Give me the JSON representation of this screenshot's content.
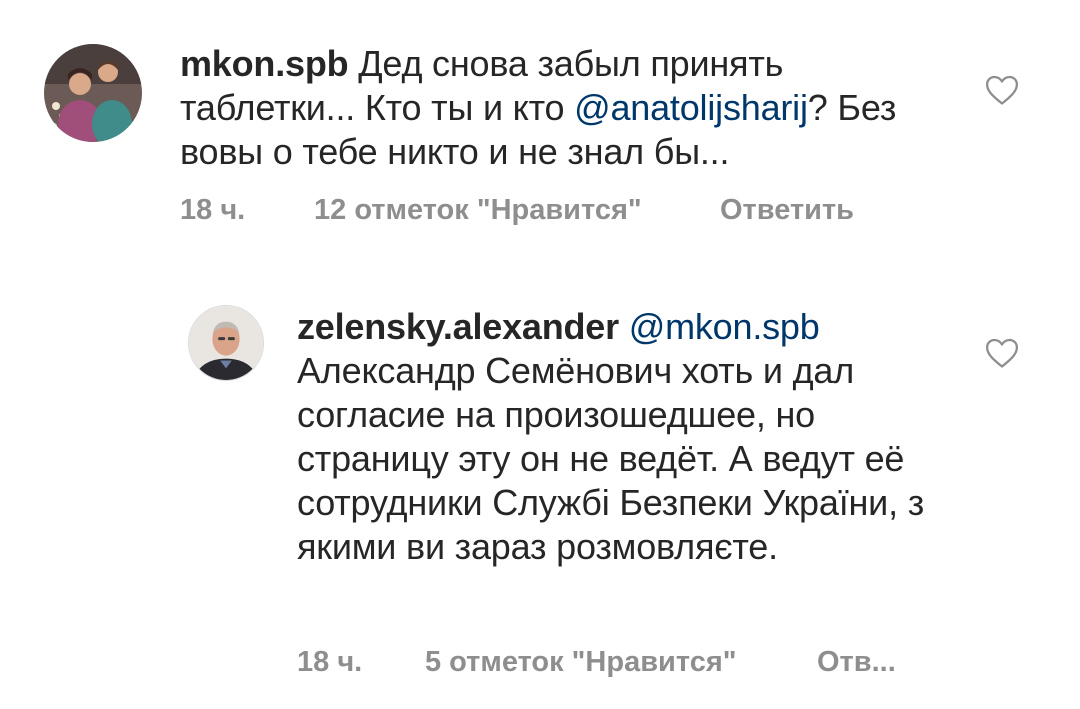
{
  "comments": [
    {
      "username": "mkon.spb",
      "text_before_mention": "Дед снова забыл принять таблетки... Кто ты и кто ",
      "mention": "@anatolijsharij",
      "text_after_mention": "? Без вовы о тебе никто и не знал бы...",
      "time": "18 ч.",
      "likes": "12 отметок \"Нравится\"",
      "reply_label": "Ответить",
      "like_icon": "heart-outline-icon"
    },
    {
      "username": "zelensky.alexander",
      "mention": "@mkon.spb",
      "text": "Александр Семёнович хоть и дал согласие на произошедшее, но страницу эту он не ведёт. А ведут её сотрудники Службi Безпеки України, з якими ви зараз розмовляєте.",
      "time": "18 ч.",
      "likes": "5 отметок \"Нравится\"",
      "reply_label": "Отв...",
      "like_icon": "heart-outline-icon"
    }
  ],
  "colors": {
    "text": "#262626",
    "mention": "#00376b",
    "meta": "#8e8e8e"
  }
}
